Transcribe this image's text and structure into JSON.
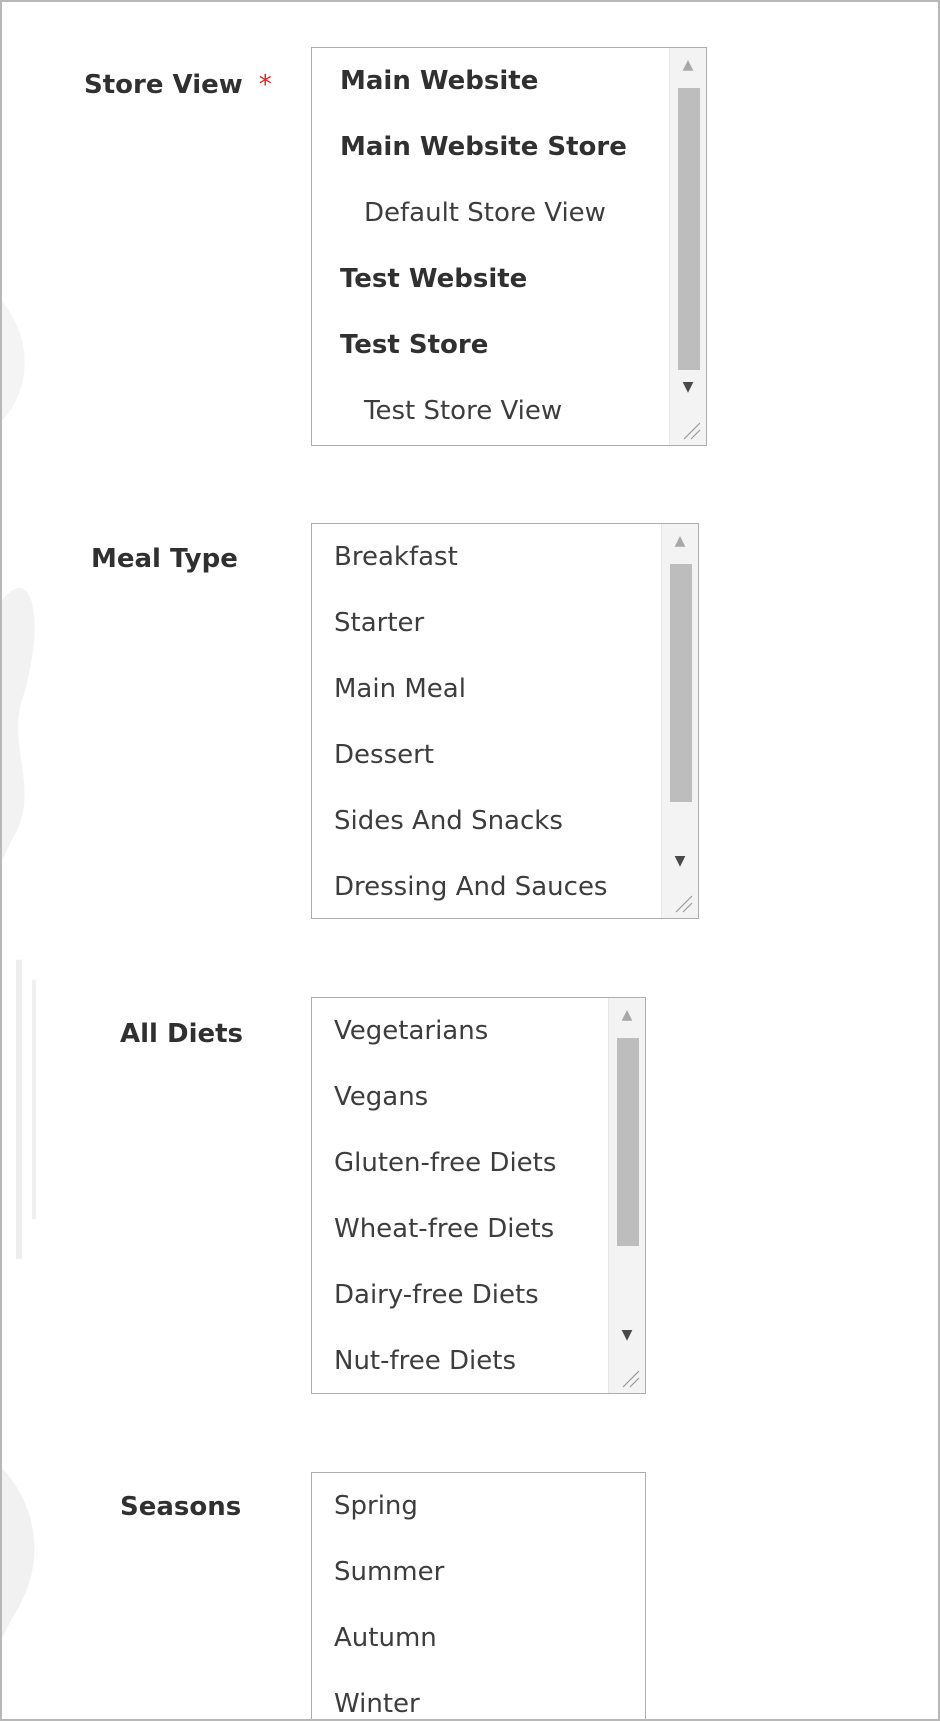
{
  "fields": {
    "store_view": {
      "label": "Store View",
      "required_mark": "*",
      "options": [
        {
          "text": "Main Website",
          "kind": "group"
        },
        {
          "text": "Main Website Store",
          "kind": "group"
        },
        {
          "text": "Default Store View",
          "kind": "child"
        },
        {
          "text": "Test Website",
          "kind": "group"
        },
        {
          "text": "Test Store",
          "kind": "group"
        },
        {
          "text": "Test Store View",
          "kind": "child"
        }
      ]
    },
    "meal_type": {
      "label": "Meal Type",
      "options": [
        {
          "text": "Breakfast"
        },
        {
          "text": "Starter"
        },
        {
          "text": "Main Meal"
        },
        {
          "text": "Dessert"
        },
        {
          "text": "Sides And Snacks"
        },
        {
          "text": "Dressing And Sauces"
        }
      ]
    },
    "all_diets": {
      "label": "All Diets",
      "options": [
        {
          "text": "Vegetarians"
        },
        {
          "text": "Vegans"
        },
        {
          "text": "Gluten-free Diets"
        },
        {
          "text": "Wheat-free Diets"
        },
        {
          "text": "Dairy-free Diets"
        },
        {
          "text": "Nut-free Diets"
        }
      ]
    },
    "seasons": {
      "label": "Seasons",
      "options": [
        {
          "text": "Spring"
        },
        {
          "text": "Summer"
        },
        {
          "text": "Autumn"
        },
        {
          "text": "Winter"
        }
      ]
    }
  },
  "icons": {
    "scroll_up": "triangle-up-icon",
    "scroll_down": "triangle-down-icon",
    "resize": "resize-grip-icon"
  }
}
